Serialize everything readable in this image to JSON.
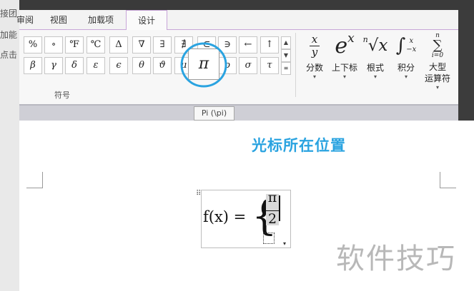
{
  "background_app": {
    "left_strip_texts": [
      "接团",
      "加能",
      "点击"
    ]
  },
  "ribbon": {
    "tabs": [
      {
        "label": "审阅",
        "active": false
      },
      {
        "label": "视图",
        "active": false
      },
      {
        "label": "加载项",
        "active": false
      },
      {
        "label": "设计",
        "active": true
      }
    ],
    "symbols_row1": [
      "%",
      "∘",
      "℉",
      "℃",
      "Δ",
      "∇",
      "∃",
      "∄",
      "⊂",
      "∋",
      "←",
      "↑"
    ],
    "symbols_row2": [
      "β",
      "γ",
      "δ",
      "ε",
      "ϵ",
      "θ",
      "ϑ",
      "μ",
      "ρ",
      "σ",
      "τ"
    ],
    "highlighted_symbol": "π",
    "group_label": "符号",
    "tools": [
      {
        "label": "分数",
        "icon": "fraction-icon",
        "glyph_top": "x",
        "glyph_bottom": "y"
      },
      {
        "label": "上下标",
        "icon": "script-icon",
        "glyph": "e",
        "glyph_sup": "x"
      },
      {
        "label": "根式",
        "icon": "radical-icon",
        "glyph_index": "n",
        "glyph": "√x"
      },
      {
        "label": "积分",
        "icon": "integral-icon",
        "glyph": "∫",
        "glyph_sup": "x",
        "glyph_sub": "−x"
      },
      {
        "label": "大型\n运算符",
        "icon": "summation-icon",
        "glyph": "∑",
        "glyph_sup": "n",
        "glyph_sub": "i=0"
      }
    ]
  },
  "tooltip": {
    "text": "Pi (\\pi)"
  },
  "equation": {
    "lhs": "f(x) =",
    "brace": "{",
    "open_paren": "(",
    "numerator": "π",
    "denominator": "2",
    "menu_arrow": "▾"
  },
  "annotation": {
    "text": "光标所在位置",
    "color": "#2aa3e0"
  },
  "watermark": {
    "text": "软件技巧"
  },
  "colors": {
    "accent": "#2aa3e0",
    "active_tab_border": "#c8a6d8"
  }
}
